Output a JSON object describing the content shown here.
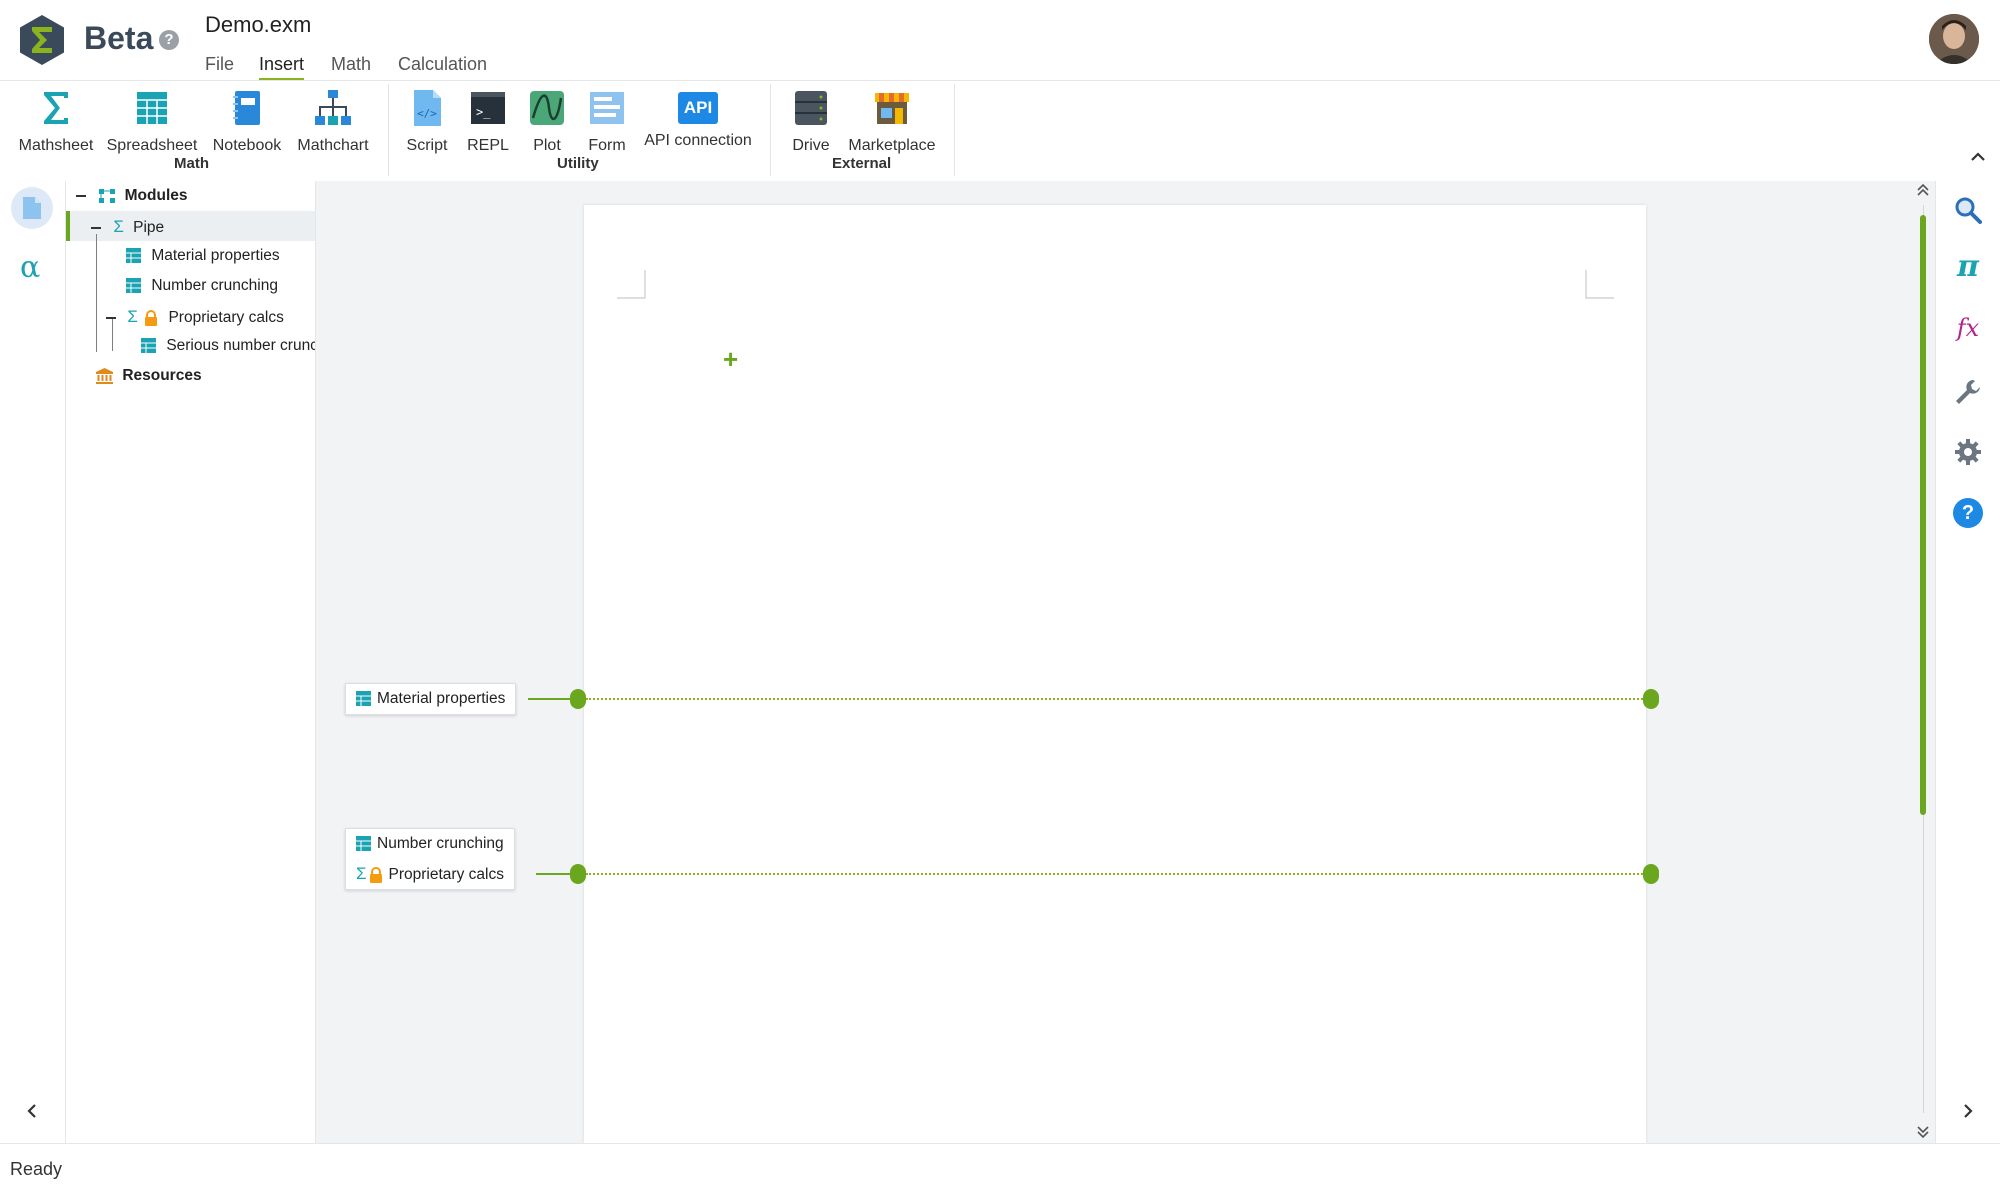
{
  "app": {
    "badge": "Beta",
    "help": "?",
    "document_title": "Demo.exm"
  },
  "menu": [
    "File",
    "Insert",
    "Math",
    "Calculation"
  ],
  "ribbon": {
    "math": {
      "group": "Math",
      "items": [
        "Mathsheet",
        "Spreadsheet",
        "Notebook",
        "Mathchart"
      ]
    },
    "utility": {
      "group": "Utility",
      "items": [
        "Script",
        "REPL",
        "Plot",
        "Form",
        "API connection"
      ],
      "api_icon_text": "API"
    },
    "external": {
      "group": "External",
      "items": [
        "Drive",
        "Marketplace"
      ]
    }
  },
  "tree": {
    "modules": "Modules",
    "pipe": "Pipe",
    "material_properties": "Material properties",
    "number_crunching": "Number crunching",
    "proprietary_calcs": "Proprietary calcs",
    "serious_number_crunching": "Serious number crunching",
    "resources": "Resources"
  },
  "canvas": {
    "link1": {
      "items": [
        "Material properties"
      ]
    },
    "link2": {
      "items": [
        "Number crunching",
        "Proprietary calcs"
      ]
    },
    "add_symbol": "+"
  },
  "status": {
    "text": "Ready"
  },
  "colors": {
    "accent_green": "#6aa61e",
    "teal": "#1aa3b3",
    "brand_slate": "#3a4a5a",
    "help_blue": "#1e88e5",
    "fx_magenta": "#b4258c",
    "lock_orange": "#f39c12"
  }
}
